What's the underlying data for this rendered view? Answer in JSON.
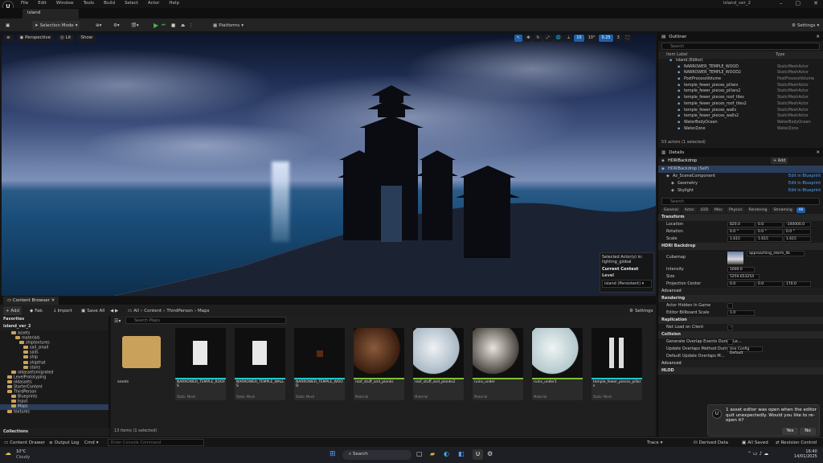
{
  "menubar": {
    "logo": "U",
    "menus": [
      "File",
      "Edit",
      "Window",
      "Tools",
      "Build",
      "Select",
      "Actor",
      "Help"
    ],
    "project": "island_ver_2",
    "window_buttons": [
      "–",
      "▢",
      "✕"
    ]
  },
  "level_tab": "island",
  "toolbar": {
    "selection_mode": "Selection Mode",
    "platforms": "Platforms",
    "settings": "Settings"
  },
  "viewport": {
    "perspective": "Perspective",
    "lit": "Lit",
    "show": "Show",
    "right_controls": [
      "10",
      "10°",
      "0.25",
      "3"
    ],
    "selected_actor_label": "Selected Actor(s) in:",
    "selected_actor_value": "lighting_global",
    "current_context": "Current Context",
    "level_label": "Level",
    "level_value": "island (Persistent)"
  },
  "outliner": {
    "title": "Outliner",
    "search_placeholder": "Search",
    "col_label": "Item Label",
    "col_type": "Type",
    "rows": [
      {
        "name": "island (Editor)",
        "type": ""
      },
      {
        "name": "NARROWER_TEMPLE_WOOD",
        "type": "StaticMeshActor"
      },
      {
        "name": "NARROWER_TEMPLE_WOOD2",
        "type": "StaticMeshActor"
      },
      {
        "name": "PostProcessVolume",
        "type": "PostProcessVolume"
      },
      {
        "name": "temple_fewer_pieces_pillars",
        "type": "StaticMeshActor"
      },
      {
        "name": "temple_fewer_pieces_pillars2",
        "type": "StaticMeshActor"
      },
      {
        "name": "temple_fewer_pieces_roof_tiles",
        "type": "StaticMeshActor"
      },
      {
        "name": "temple_fewer_pieces_roof_tiles2",
        "type": "StaticMeshActor"
      },
      {
        "name": "temple_fewer_pieces_walls",
        "type": "StaticMeshActor"
      },
      {
        "name": "temple_fewer_pieces_walls2",
        "type": "StaticMeshActor"
      },
      {
        "name": "WaterBodyOcean",
        "type": "WaterBodyOcean"
      },
      {
        "name": "WaterZone",
        "type": "WaterZone"
      }
    ],
    "count": "53 actors (1 selected)"
  },
  "details": {
    "title": "Details",
    "actor": "HDRIBackdrop",
    "add": "+ Add",
    "components": [
      {
        "name": "HDRIBackdrop (Self)",
        "link": ""
      },
      {
        "name": "Az_SceneComponent",
        "link": "Edit in Blueprint"
      },
      {
        "name": "Geometry",
        "link": "Edit in Blueprint"
      },
      {
        "name": "Skylight",
        "link": "Edit in Blueprint"
      }
    ],
    "search_placeholder": "Search",
    "categories": [
      "General",
      "Actor",
      "LOD",
      "Misc",
      "Physics",
      "Rendering",
      "Streaming",
      "All"
    ],
    "transform": "Transform",
    "location": {
      "label": "Location",
      "x": "820.0",
      "y": "0.0",
      "z": "-100000.0"
    },
    "rotation": {
      "label": "Rotation",
      "x": "0.0 °",
      "y": "0.0 °",
      "z": "0.0 °"
    },
    "scale": {
      "label": "Scale",
      "x": "1.615",
      "y": "1.615",
      "z": "1.615"
    },
    "hdri_section": "HDRI Backdrop",
    "cubemap_label": "Cubemap",
    "cubemap_value": "approaching_storm_4k",
    "intensity_label": "Intensity",
    "intensity_value": "1600.0",
    "size_label": "Size",
    "size_value": "5250.653254",
    "projection_label": "Projection Center",
    "projection_x": "0.0",
    "projection_y": "0.0",
    "projection_z": "170.0",
    "advanced": "Advanced",
    "rendering": "Rendering",
    "actor_hidden": "Actor Hidden In Game",
    "billboard_label": "Editor Billboard Scale",
    "billboard_value": "1.0",
    "replication": "Replication",
    "net_load": "Net Load on Client",
    "collision": "Collision",
    "overlap_label": "Generate Overlap Events During Le...",
    "update_overlap": "Update Overlaps Method During L...",
    "update_overlap_value": "Use Config Default",
    "default_overlap": "Default Update Overlaps M...",
    "advanced2": "Advanced",
    "hlod": "HLOD"
  },
  "content_browser": {
    "tab": "Content Browser",
    "add": "+ Add",
    "fab": "Fab",
    "import": "Import",
    "save_all": "Save All",
    "path": [
      "All",
      "Content",
      "ThirdPerson",
      "Maps"
    ],
    "settings": "Settings",
    "favorites": "Favorites",
    "root": "island_ver_2",
    "search_placeholder": "Search Maps",
    "tree": [
      "assets",
      "materials",
      "shiptextures",
      "sail_small",
      "sails",
      "ship",
      "shipthat",
      "stairs",
      "oldassetsmigrated",
      "LevelPrototyping",
      "oldassets",
      "StarterContent",
      "ThirdPerson",
      "Blueprints",
      "Input",
      "Maps",
      "textures"
    ],
    "collections": "Collections",
    "item_count": "13 items (1 selected)",
    "tiles": [
      {
        "name": "assets",
        "type": ""
      },
      {
        "name": "NARROWER_TEMPLE_ROOFS",
        "type": "Static Mesh"
      },
      {
        "name": "NARROWER_TEMPLE_WALLS",
        "type": "Static Mesh"
      },
      {
        "name": "NARROWER_TEMPLE_WOOD",
        "type": "Static Mesh"
      },
      {
        "name": "roof_stuff_and_planks",
        "type": "Material"
      },
      {
        "name": "roof_stuff_and_planks2",
        "type": "Material"
      },
      {
        "name": "ruins_under",
        "type": "Material"
      },
      {
        "name": "ruins_under1",
        "type": "Material"
      },
      {
        "name": "temple_fewer_pieces_pillars",
        "type": "Static Mesh"
      }
    ]
  },
  "statusbar": {
    "content_drawer": "Content Drawer",
    "output_log": "Output Log",
    "cmd": "Cmd",
    "console_placeholder": "Enter Console Command",
    "trace": "Trace",
    "derived_data": "Derived Data",
    "all_saved": "All Saved",
    "revision_control": "Revision Control"
  },
  "toast": {
    "message": "1 asset editor was open when the editor quit unexpectedly. Would you like to re-open it?",
    "yes": "Yes",
    "no": "No"
  },
  "taskbar": {
    "weather_temp": "10°C",
    "weather_desc": "Cloudy",
    "search": "Search",
    "time": "16:40",
    "date": "14/01/2025"
  }
}
